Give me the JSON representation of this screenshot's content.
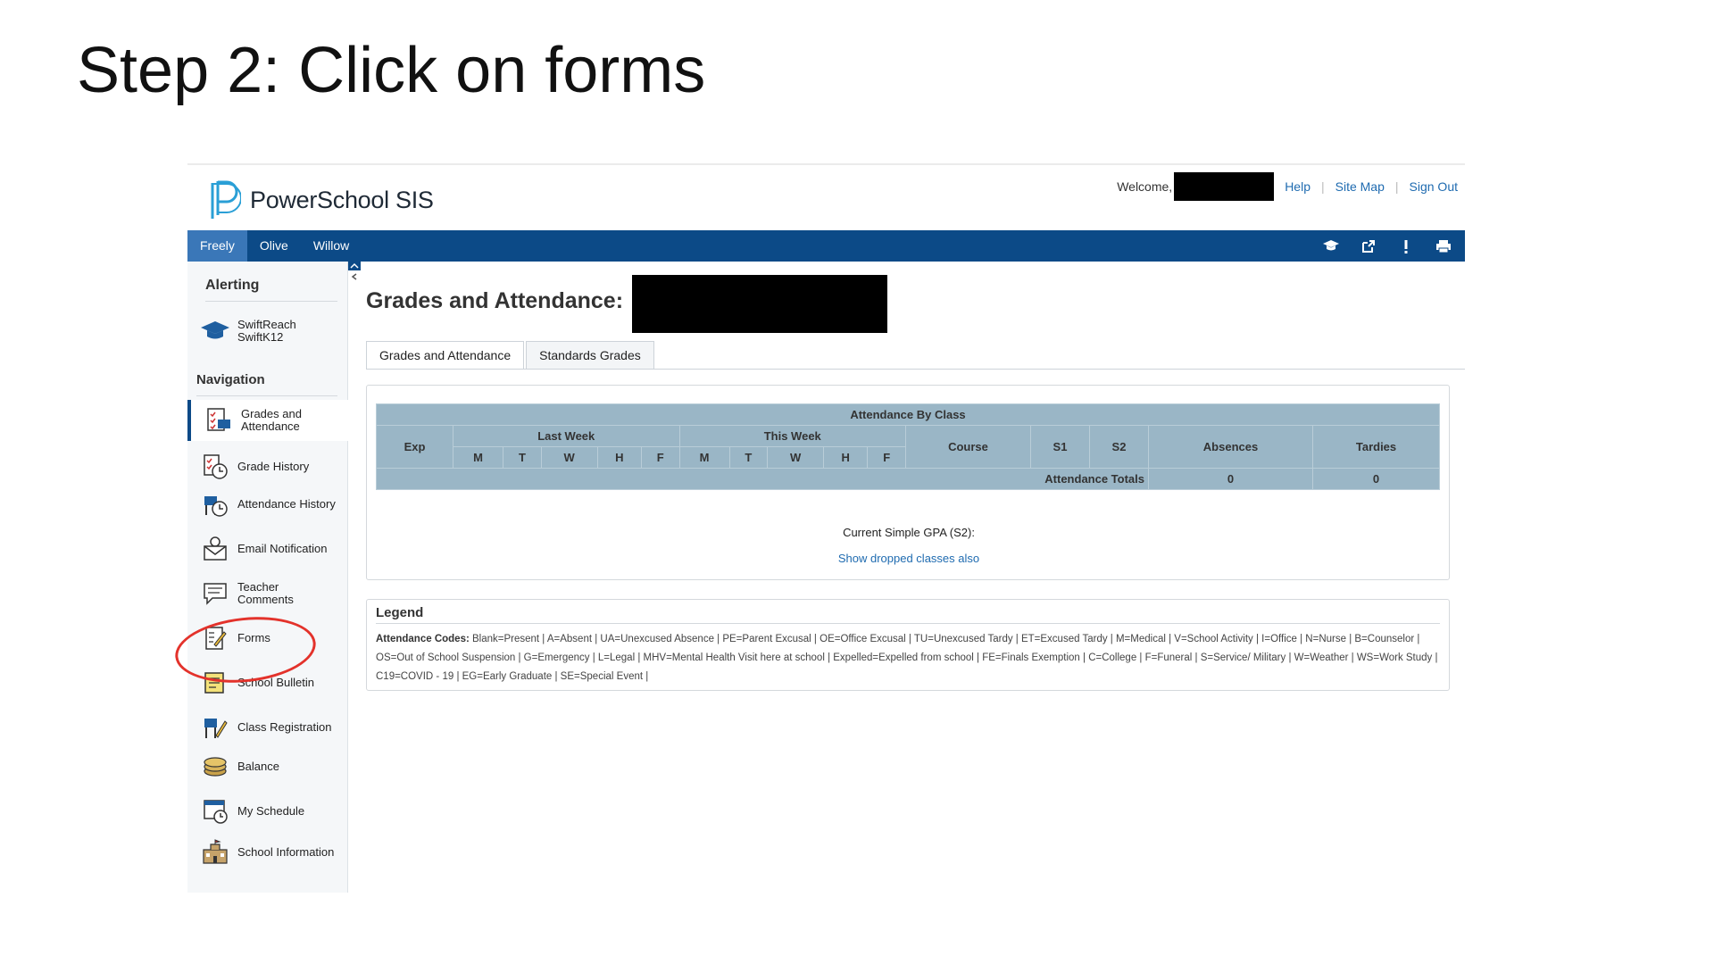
{
  "slide": {
    "title": "Step 2: Click on forms"
  },
  "header": {
    "brand": "PowerSchool SIS",
    "welcome": "Welcome,",
    "links": [
      "Help",
      "Site Map",
      "Sign Out"
    ]
  },
  "students": [
    "Freely",
    "Olive",
    "Willow"
  ],
  "active_student": "Freely",
  "nav_icons": [
    "graduation-cap-icon",
    "external-link-icon",
    "alert-icon",
    "printer-icon"
  ],
  "sidebar": {
    "alerting_heading": "Alerting",
    "alerting_items": [
      {
        "label": "SwiftReach SwiftK12",
        "icon": "graduation-cap-icon"
      }
    ],
    "navigation_heading": "Navigation",
    "items": [
      {
        "label": "Grades and Attendance",
        "icon": "grades-icon"
      },
      {
        "label": "Grade History",
        "icon": "grade-history-icon"
      },
      {
        "label": "Attendance History",
        "icon": "attendance-history-icon"
      },
      {
        "label": "Email Notification",
        "icon": "email-icon"
      },
      {
        "label": "Teacher Comments",
        "icon": "comments-icon"
      },
      {
        "label": "Forms",
        "icon": "forms-icon"
      },
      {
        "label": "School Bulletin",
        "icon": "bulletin-icon"
      },
      {
        "label": "Class Registration",
        "icon": "registration-icon"
      },
      {
        "label": "Balance",
        "icon": "balance-icon"
      },
      {
        "label": "My Schedule",
        "icon": "schedule-icon"
      },
      {
        "label": "School Information",
        "icon": "school-icon"
      }
    ],
    "active_item": "Grades and Attendance",
    "highlighted_item": "Forms"
  },
  "main": {
    "title": "Grades and Attendance:",
    "tabs": [
      "Grades and Attendance",
      "Standards Grades"
    ],
    "active_tab": "Grades and Attendance",
    "attendance_table": {
      "caption": "Attendance By Class",
      "col_exp": "Exp",
      "last_week": "Last Week",
      "this_week": "This Week",
      "days": [
        "M",
        "T",
        "W",
        "H",
        "F"
      ],
      "col_course": "Course",
      "col_s1": "S1",
      "col_s2": "S2",
      "col_absences": "Absences",
      "col_tardies": "Tardies",
      "totals_label": "Attendance Totals",
      "total_absences": "0",
      "total_tardies": "0"
    },
    "gpa_text": "Current Simple GPA (S2):",
    "dropped_link": "Show dropped classes also",
    "legend": {
      "title": "Legend",
      "codes_label": "Attendance Codes:",
      "codes_text": "Blank=Present | A=Absent | UA=Unexcused Absence | PE=Parent Excusal | OE=Office Excusal | TU=Unexcused Tardy | ET=Excused Tardy | M=Medical | V=School Activity | I=Office | N=Nurse | B=Counselor | OS=Out of School Suspension | G=Emergency | L=Legal | MHV=Mental Health Visit here at school | Expelled=Expelled from school | FE=Finals Exemption | C=College | F=Funeral | S=Service/ Military | W=Weather | WS=Work Study | C19=COVID - 19 | EG=Early Graduate | SE=Special Event |"
    }
  },
  "colors": {
    "navbar": "#0c4a87",
    "active_tab": "#3a77b8",
    "table_bg": "#9ab6c6",
    "link": "#1f6bb0",
    "annotation": "#e3322b"
  }
}
